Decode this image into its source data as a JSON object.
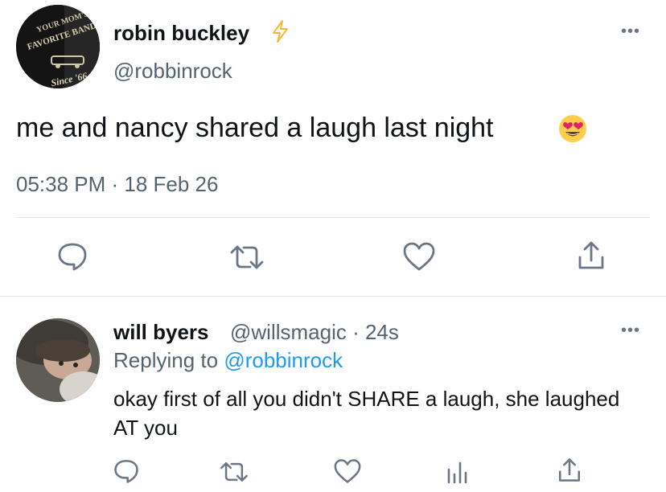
{
  "tweet": {
    "author_name": "robin buckley",
    "author_handle": "@robbinrock",
    "text": "me and nancy shared a laugh last night",
    "emoji": "heart-eyes-emoji",
    "timestamp": "05:38 PM · 18 Feb 26",
    "more_label": "•••",
    "avatar_text": {
      "line1": "YOUR MOM'S",
      "line2": "FAVORITE BAND",
      "line3": "Since '66"
    }
  },
  "reply": {
    "author_name": "will byers",
    "author_handle": "@willsmagic",
    "time": "· 24s",
    "replying_prefix": "Replying to",
    "replying_handle": "@robbinrock",
    "text": "okay first of all you didn't SHARE a laugh, she laughed AT you",
    "more_label": "•••"
  },
  "icons": {
    "reply": "reply-icon",
    "retweet": "retweet-icon",
    "like": "heart-icon",
    "share": "share-icon",
    "analytics": "analytics-icon",
    "verified": "lightning-icon"
  },
  "colors": {
    "text": "#0f1419",
    "secondary": "#536471",
    "link": "#1d9bf0",
    "icon": "#6b7785",
    "bolt": "#f6b93b"
  }
}
